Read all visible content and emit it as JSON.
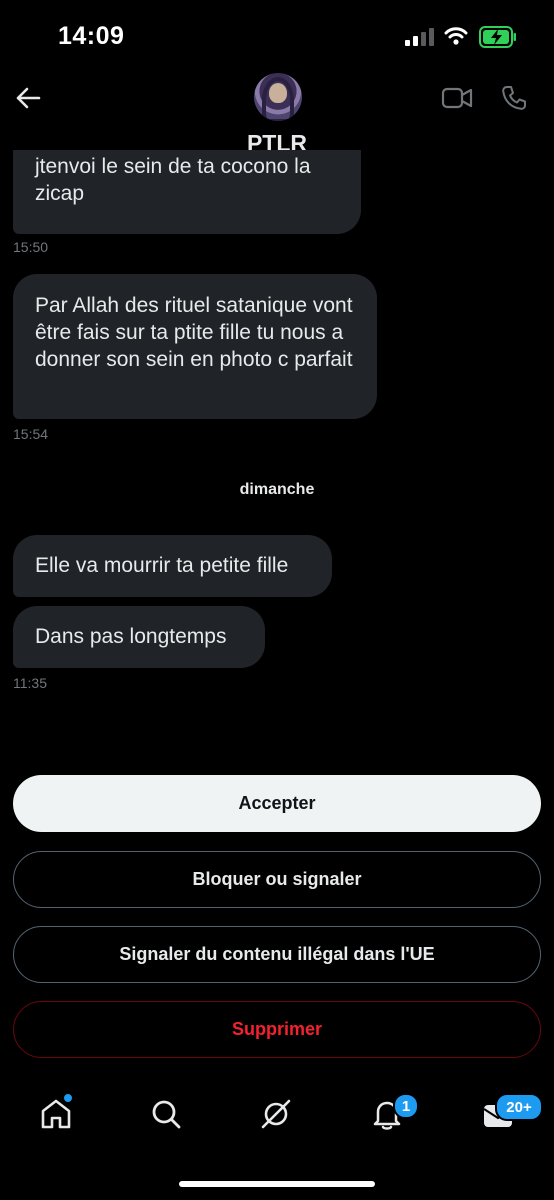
{
  "status_bar": {
    "time": "14:09"
  },
  "header": {
    "contact_name": "PTLR"
  },
  "messages": [
    {
      "text": "jtenvoi le sein de ta cocono la zicap"
    },
    {
      "text": "Par Allah des rituel satanique vont être fais sur ta ptite fille tu nous a donner son sein en photo c parfait"
    },
    {
      "text": "Elle va mourrir ta petite fille"
    },
    {
      "text": "Dans pas longtemps"
    }
  ],
  "timestamps": [
    "15:50",
    "15:54",
    "11:35"
  ],
  "day_separator": "dimanche",
  "actions": {
    "accept": "Accepter",
    "block": "Bloquer ou signaler",
    "report": "Signaler du contenu illégal dans l'UE",
    "delete": "Supprimer"
  },
  "bottom_nav": {
    "items": [
      "home-icon",
      "search-icon",
      "grok-icon",
      "notifications-icon",
      "messages-icon"
    ],
    "notifications_badge": "1",
    "messages_badge": "20+"
  },
  "colors": {
    "accent": "#1d9bf0",
    "danger": "#f4212e",
    "bubble": "#202327",
    "battery": "#30d158"
  }
}
